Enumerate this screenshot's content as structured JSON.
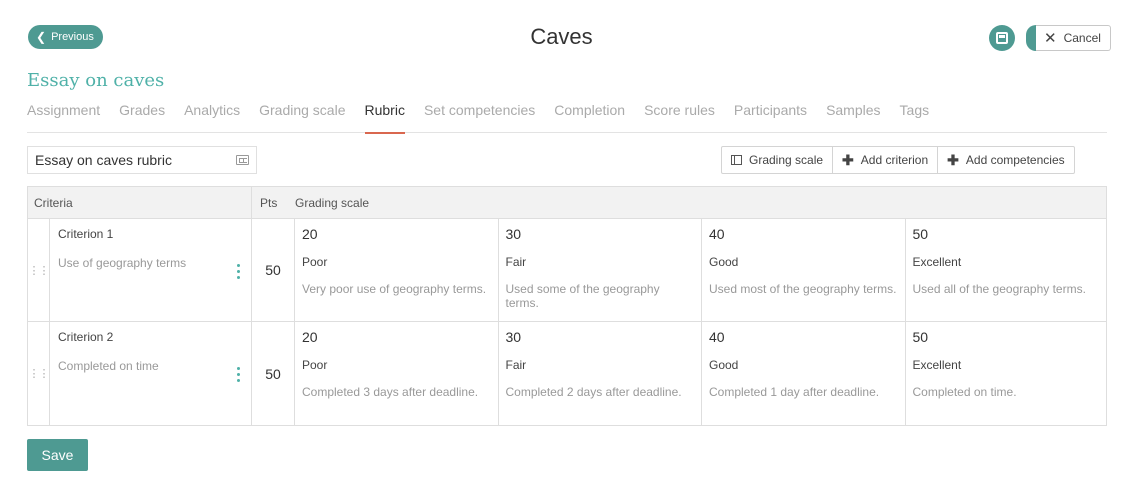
{
  "header": {
    "previous_label": "Previous",
    "title": "Caves",
    "cancel_label": "Cancel"
  },
  "assignment": {
    "title": "Essay on caves"
  },
  "tabs": [
    {
      "label": "Assignment"
    },
    {
      "label": "Grades"
    },
    {
      "label": "Analytics"
    },
    {
      "label": "Grading scale"
    },
    {
      "label": "Rubric",
      "active": true
    },
    {
      "label": "Set competencies"
    },
    {
      "label": "Completion"
    },
    {
      "label": "Score rules"
    },
    {
      "label": "Participants"
    },
    {
      "label": "Samples"
    },
    {
      "label": "Tags"
    }
  ],
  "rubric": {
    "name": "Essay on caves rubric"
  },
  "actions": {
    "grading_scale": "Grading scale",
    "add_criterion": "Add criterion",
    "add_competencies": "Add competencies"
  },
  "table": {
    "headers": {
      "criteria": "Criteria",
      "pts": "Pts",
      "grading_scale": "Grading scale"
    },
    "rows": [
      {
        "name": "Criterion 1",
        "description": "Use of geography terms",
        "pts": "50",
        "levels": [
          {
            "pts": "20",
            "name": "Poor",
            "desc": "Very poor use of geography terms."
          },
          {
            "pts": "30",
            "name": "Fair",
            "desc": "Used some of the geography terms."
          },
          {
            "pts": "40",
            "name": "Good",
            "desc": "Used most of the geography terms."
          },
          {
            "pts": "50",
            "name": "Excellent",
            "desc": "Used all of the geography terms."
          }
        ]
      },
      {
        "name": "Criterion 2",
        "description": "Completed on time",
        "pts": "50",
        "levels": [
          {
            "pts": "20",
            "name": "Poor",
            "desc": "Completed 3 days after deadline."
          },
          {
            "pts": "30",
            "name": "Fair",
            "desc": "Completed 2 days after deadline."
          },
          {
            "pts": "40",
            "name": "Good",
            "desc": "Completed 1 day after deadline."
          },
          {
            "pts": "50",
            "name": "Excellent",
            "desc": "Completed on time."
          }
        ]
      }
    ]
  },
  "footer": {
    "save_label": "Save"
  },
  "colors": {
    "accent": "#4e9a92",
    "title_teal": "#4fb1a8",
    "tab_underline": "#d9674f"
  },
  "icons": {
    "previous": "chevron-left-icon",
    "save": "floppy-disk-icon",
    "cancel": "close-icon",
    "rubric_name": "card-icon",
    "grading_scale": "grid-icon",
    "add": "plus-icon",
    "drag": "drag-handle-icon",
    "menu": "kebab-menu-icon"
  }
}
